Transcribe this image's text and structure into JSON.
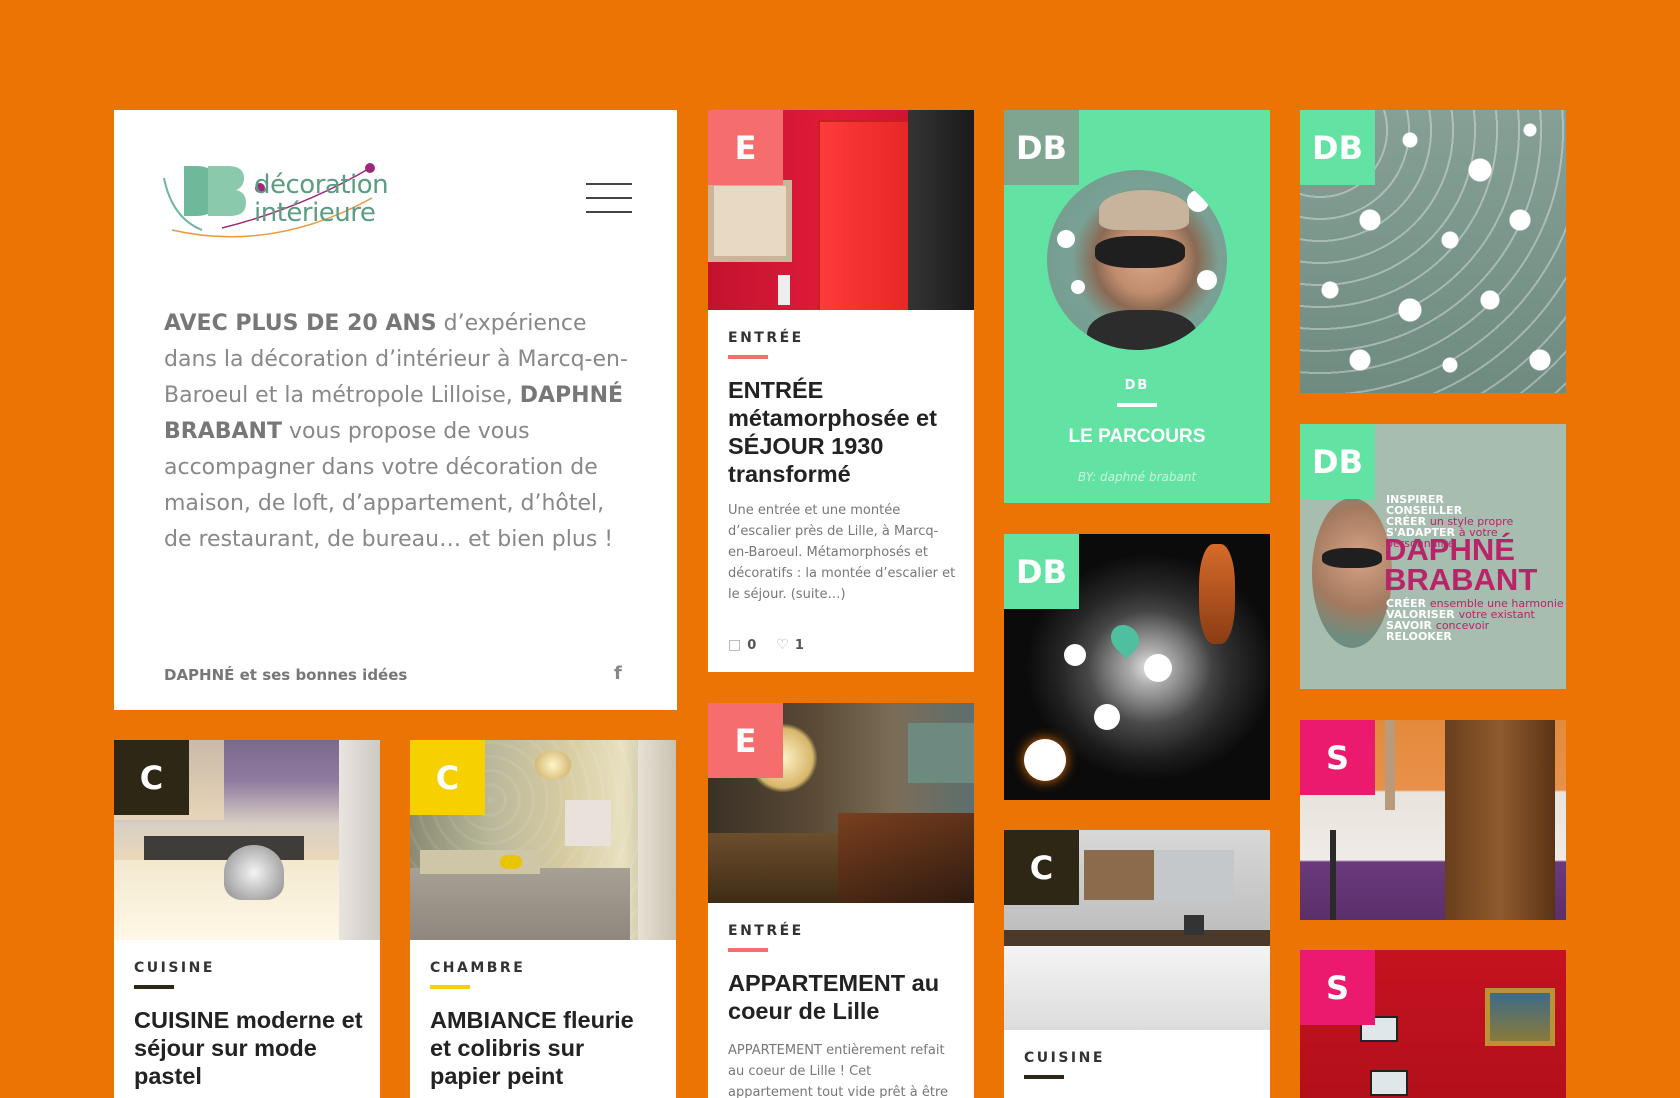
{
  "intro_card": {
    "logo_text_line1": "décoration",
    "logo_text_line2": "intérieure",
    "paragraph_strong1": "AVEC PLUS DE 20 ANS",
    "paragraph_part2": " d’expérience dans la décoration d’intérieur à Marcq-en-Baroeul et la métropole Lilloise, ",
    "paragraph_strong2": "DAPHNÉ BRABANT",
    "paragraph_part3": " vous propose de vous accompagner dans votre décoration de maison, de loft, d’appartement, d’hôtel, de restaurant, de bureau… et bien plus !",
    "footer_text": "DAPHNÉ et ses bonnes idées",
    "facebook_icon": "f"
  },
  "colors": {
    "background": "#ec7404",
    "entree": "#f56d6d",
    "db": "#63e3a3",
    "cuisine": "#2f2715",
    "chambre": "#f7d000",
    "salon": "#ec1a6e"
  },
  "posts": {
    "entree1": {
      "badge": "E",
      "category": "ENTRÉE",
      "title": "ENTRÉE métamorphosée et SÉJOUR 1930 transformé",
      "excerpt": "Une entrée et une montée d’escalier près de Lille, à Marcq-en-Baroeul. Métamorphosés et décoratifs : la montée d’escalier et le séjour. (suite…)",
      "comments": "0",
      "likes": "1"
    },
    "entree2": {
      "badge": "E",
      "category": "ENTRÉE",
      "title": "APPARTEMENT au coeur de Lille",
      "excerpt": "APPARTEMENT entièrement refait au coeur de Lille ! Cet appartement tout vide prêt à être"
    },
    "parcours": {
      "badge": "DB",
      "category": "DB",
      "title": "LE PARCOURS",
      "byline": "BY: daphné brabant"
    },
    "cuisine1": {
      "badge": "C",
      "category": "CUISINE",
      "title": "CUISINE moderne et séjour sur mode pastel"
    },
    "chambre1": {
      "badge": "C",
      "category": "CHAMBRE",
      "title": "AMBIANCE fleurie et colibris sur papier peint"
    },
    "cuisine2": {
      "badge": "C",
      "category": "CUISINE"
    },
    "db_pattern": {
      "badge": "DB"
    },
    "db_space": {
      "badge": "DB"
    },
    "db_brand": {
      "badge": "DB",
      "words_top": [
        "INSPIRER",
        "CONSEILLER",
        "CRÉER",
        "S'ADAPTER"
      ],
      "words_top_extra": [
        "un style propre",
        "à votre personnalité"
      ],
      "brand_line1": "DAPHNÉ",
      "brand_line2": "BRABANT",
      "words_bottom": [
        "CRÉER",
        "VALORISER",
        "SAVOIR",
        "RELOOKER"
      ],
      "words_bottom_extra": [
        "ensemble une harmonie",
        "votre existant",
        "concevoir"
      ]
    },
    "salon1": {
      "badge": "S"
    },
    "salon2": {
      "badge": "S"
    }
  }
}
